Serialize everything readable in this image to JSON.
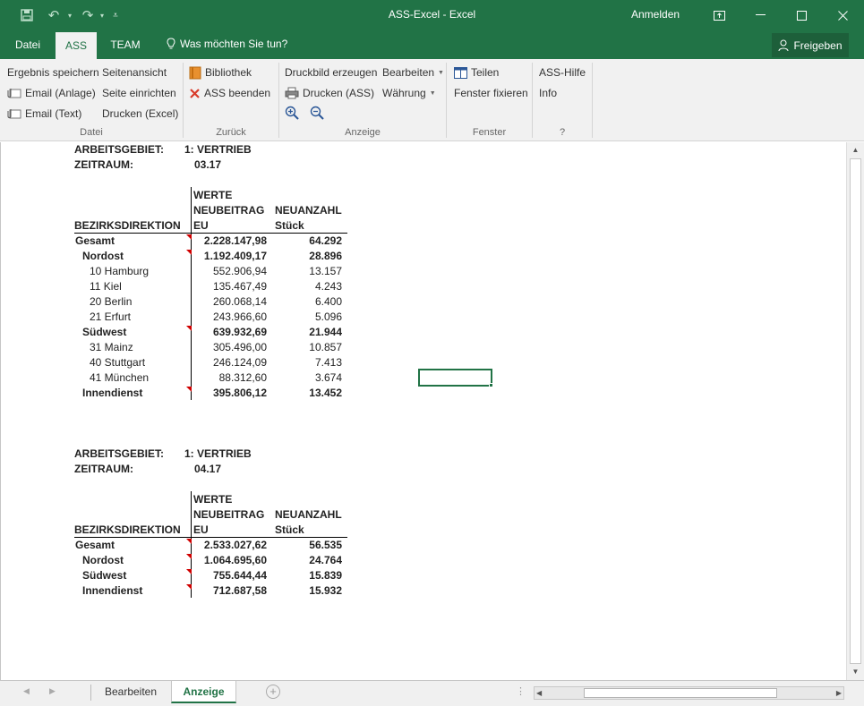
{
  "window": {
    "title": "ASS-Excel  -  Excel",
    "signin": "Anmelden",
    "share": "Freigeben"
  },
  "tabs": {
    "file": "Datei",
    "ass": "ASS",
    "team": "TEAM",
    "tellme": "Was möchten Sie tun?"
  },
  "ribbon": {
    "datei": {
      "ergebnis_speichern": "Ergebnis speichern",
      "email_anlage": "Email (Anlage)",
      "email_text": "Email (Text)",
      "seitenansicht": "Seitenansicht",
      "seite_einrichten": "Seite einrichten",
      "drucken_excel": "Drucken (Excel)",
      "group": "Datei"
    },
    "zurueck": {
      "bibliothek": "Bibliothek",
      "ass_beenden": "ASS beenden",
      "group": "Zurück"
    },
    "anzeige": {
      "druckbild": "Druckbild erzeugen",
      "drucken_ass": "Drucken (ASS)",
      "bearbeiten": "Bearbeiten",
      "waehrung": "Währung",
      "group": "Anzeige"
    },
    "fenster": {
      "teilen": "Teilen",
      "fenster_fixieren": "Fenster fixieren",
      "group": "Fenster"
    },
    "hilfe": {
      "ass_hilfe": "ASS-Hilfe",
      "info": "Info",
      "group": "?"
    }
  },
  "report1": {
    "arbeitsgebiet_label": "ARBEITSGEBIET:",
    "arbeitsgebiet_value": "1: VERTRIEB",
    "zeitraum_label": "ZEITRAUM:",
    "zeitraum_value": "03.17",
    "head_werte": "WERTE",
    "head_neubeitrag": "NEUBEITRAG",
    "head_neuanzahl": "NEUANZAHL",
    "head_bezirk": "BEZIRKSDIREKTION",
    "head_eu": "EU",
    "head_stueck": "Stück",
    "rows": [
      {
        "label": "Gesamt",
        "eu": "2.228.147,98",
        "stk": "64.292"
      },
      {
        "label": "Nordost",
        "eu": "1.192.409,17",
        "stk": "28.896"
      },
      {
        "label": "10 Hamburg",
        "eu": "552.906,94",
        "stk": "13.157"
      },
      {
        "label": "11 Kiel",
        "eu": "135.467,49",
        "stk": "4.243"
      },
      {
        "label": "20 Berlin",
        "eu": "260.068,14",
        "stk": "6.400"
      },
      {
        "label": "21 Erfurt",
        "eu": "243.966,60",
        "stk": "5.096"
      },
      {
        "label": "Südwest",
        "eu": "639.932,69",
        "stk": "21.944"
      },
      {
        "label": "31 Mainz",
        "eu": "305.496,00",
        "stk": "10.857"
      },
      {
        "label": "40 Stuttgart",
        "eu": "246.124,09",
        "stk": "7.413"
      },
      {
        "label": "41 München",
        "eu": "88.312,60",
        "stk": "3.674"
      },
      {
        "label": "Innendienst",
        "eu": "395.806,12",
        "stk": "13.452"
      }
    ]
  },
  "report2": {
    "arbeitsgebiet_label": "ARBEITSGEBIET:",
    "arbeitsgebiet_value": "1: VERTRIEB",
    "zeitraum_label": "ZEITRAUM:",
    "zeitraum_value": "04.17",
    "head_werte": "WERTE",
    "head_neubeitrag": "NEUBEITRAG",
    "head_neuanzahl": "NEUANZAHL",
    "head_bezirk": "BEZIRKSDIREKTION",
    "head_eu": "EU",
    "head_stueck": "Stück",
    "rows": [
      {
        "label": "Gesamt",
        "eu": "2.533.027,62",
        "stk": "56.535"
      },
      {
        "label": "Nordost",
        "eu": "1.064.695,60",
        "stk": "24.764"
      },
      {
        "label": "Südwest",
        "eu": "755.644,44",
        "stk": "15.839"
      },
      {
        "label": "Innendienst",
        "eu": "712.687,58",
        "stk": "15.932"
      }
    ]
  },
  "sheets": {
    "bearbeiten": "Bearbeiten",
    "anzeige": "Anzeige"
  },
  "colors": {
    "accent": "#217346",
    "comment_marker": "#d00000"
  }
}
